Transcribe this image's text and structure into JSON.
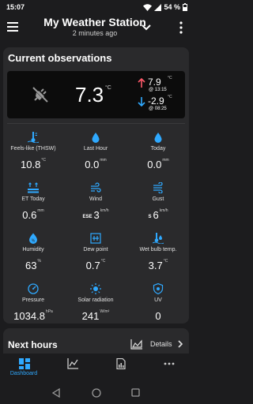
{
  "status": {
    "time": "15:07",
    "battery": "54 %"
  },
  "app_bar": {
    "title": "My Weather Station",
    "subtitle": "2 minutes ago"
  },
  "current": {
    "title": "Current observations",
    "temperature": {
      "value": "7.3",
      "unit": "°C"
    },
    "max": {
      "value": "7.9",
      "unit": "°C",
      "time": "@ 13:15"
    },
    "min": {
      "value": "-2.9",
      "unit": "°C",
      "time": "@ 08:25"
    },
    "tiles": [
      {
        "label": "Feels-like (THSW)",
        "value": "10.8",
        "unit": "°C",
        "icon": "thermometer-icon",
        "dir": ""
      },
      {
        "label": "Last Hour",
        "value": "0.0",
        "unit": "mm",
        "icon": "rain-drop-icon",
        "dir": ""
      },
      {
        "label": "Today",
        "value": "0.0",
        "unit": "mm",
        "icon": "rain-drop-icon",
        "dir": ""
      },
      {
        "label": "ET Today",
        "value": "0.6",
        "unit": "mm",
        "icon": "evapotranspiration-icon",
        "dir": ""
      },
      {
        "label": "Wind",
        "value": "3",
        "unit": "km/h",
        "icon": "wind-icon",
        "dir": "ESE"
      },
      {
        "label": "Gust",
        "value": "6",
        "unit": "km/h",
        "icon": "gust-icon",
        "dir": "S"
      },
      {
        "label": "Humidity",
        "value": "63",
        "unit": "%",
        "icon": "humidity-icon",
        "dir": ""
      },
      {
        "label": "Dew point",
        "value": "0.7",
        "unit": "°C",
        "icon": "dew-point-icon",
        "dir": ""
      },
      {
        "label": "Wet bulb temp.",
        "value": "3.7",
        "unit": "°C",
        "icon": "wet-bulb-icon",
        "dir": ""
      },
      {
        "label": "Pressure",
        "value": "1034.8",
        "unit": "hPa",
        "icon": "pressure-gauge-icon",
        "dir": ""
      },
      {
        "label": "Solar radiation",
        "value": "241",
        "unit": "W/m²",
        "icon": "sun-icon",
        "dir": ""
      },
      {
        "label": "UV",
        "value": "0",
        "unit": "",
        "icon": "uv-shield-icon",
        "dir": ""
      }
    ]
  },
  "next_hours": {
    "title": "Next hours",
    "details_label": "Details"
  },
  "bottom_nav": [
    {
      "label": "Dashboard",
      "icon": "dashboard-icon",
      "active": true
    },
    {
      "label": "",
      "icon": "chart-icon",
      "active": false
    },
    {
      "label": "",
      "icon": "report-icon",
      "active": false
    },
    {
      "label": "",
      "icon": "more-dots-icon",
      "active": false
    }
  ],
  "colors": {
    "accent": "#2fa9ff",
    "max_arrow": "#ff5a6a",
    "min_arrow": "#2fa9ff",
    "background": "#1c1c1e",
    "card": "#2a2a2c"
  }
}
